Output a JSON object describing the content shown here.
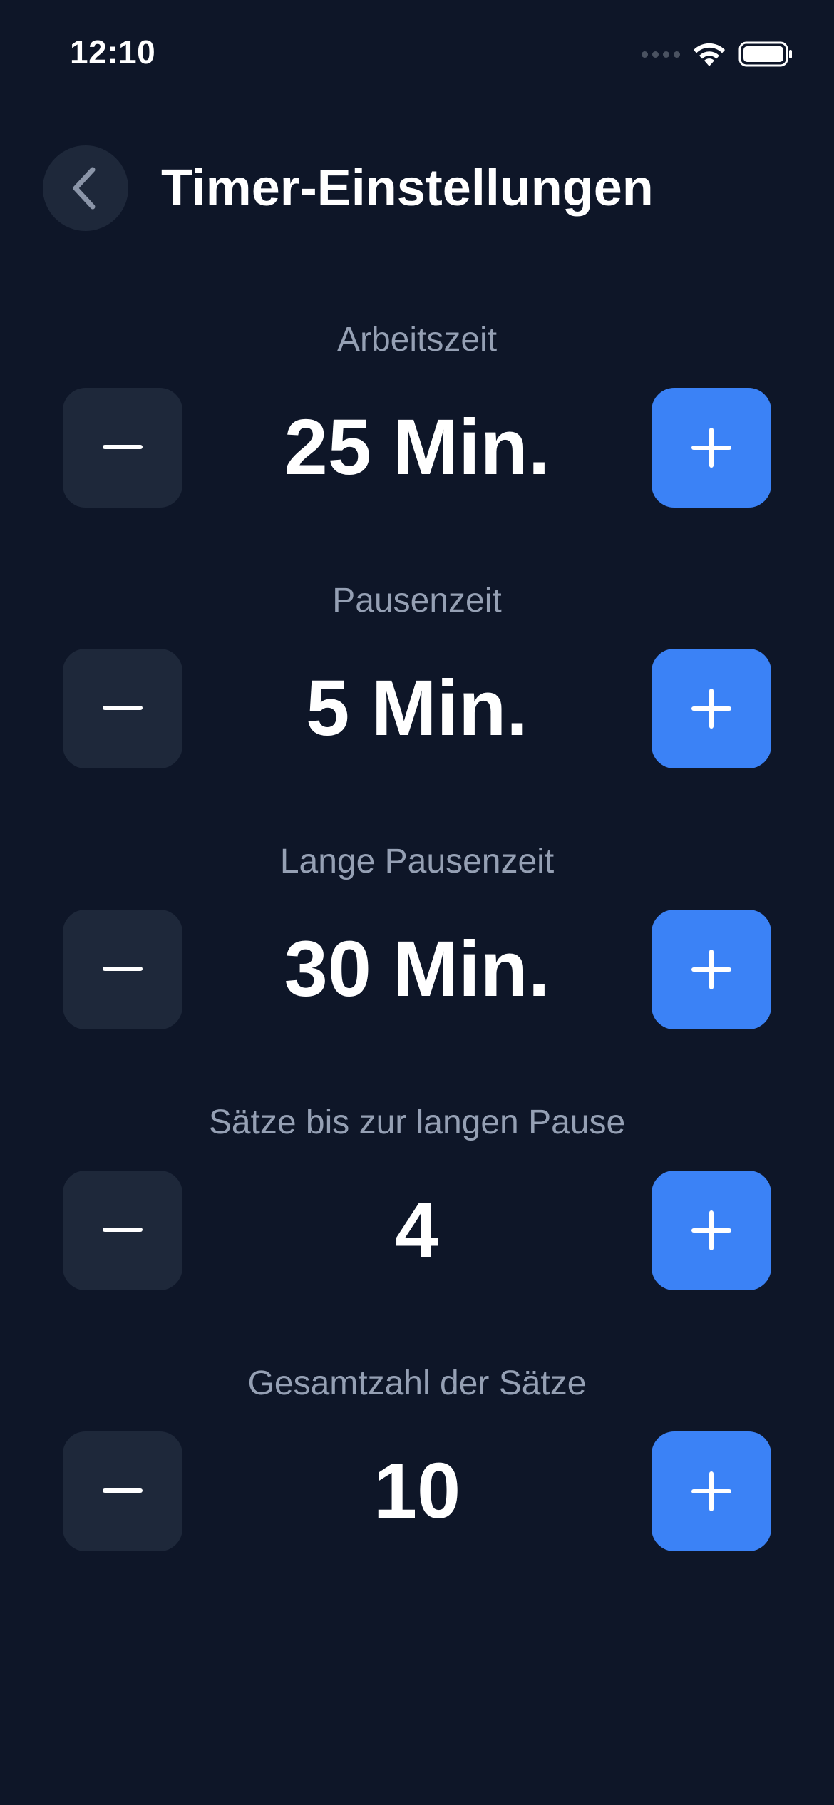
{
  "status_bar": {
    "time": "12:10",
    "icons": [
      "signal-icon",
      "wifi-icon",
      "battery-icon"
    ]
  },
  "header": {
    "back_icon": "chevron-left-icon",
    "title": "Timer-Einstellungen"
  },
  "colors": {
    "background": "#0e1628",
    "surface": "#1e283a",
    "accent": "#3b82f6",
    "label": "#95a0b4",
    "text": "#ffffff"
  },
  "settings": [
    {
      "label": "Arbeitszeit",
      "value": "25 Min.",
      "minus_icon": "minus-icon",
      "plus_icon": "plus-icon"
    },
    {
      "label": "Pausenzeit",
      "value": "5 Min.",
      "minus_icon": "minus-icon",
      "plus_icon": "plus-icon"
    },
    {
      "label": "Lange Pausenzeit",
      "value": "30 Min.",
      "minus_icon": "minus-icon",
      "plus_icon": "plus-icon"
    },
    {
      "label": "Sätze bis zur langen Pause",
      "value": "4",
      "minus_icon": "minus-icon",
      "plus_icon": "plus-icon"
    },
    {
      "label": "Gesamtzahl der Sätze",
      "value": "10",
      "minus_icon": "minus-icon",
      "plus_icon": "plus-icon"
    }
  ]
}
